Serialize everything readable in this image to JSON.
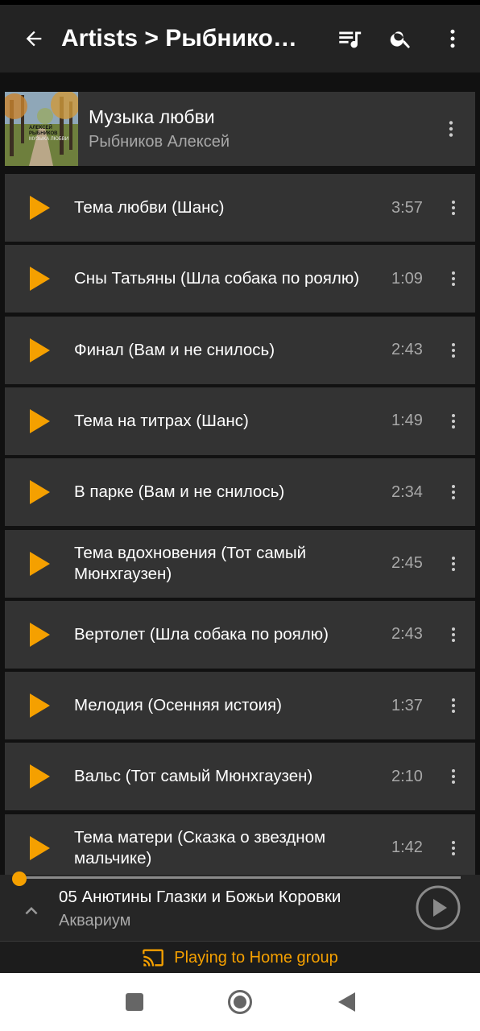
{
  "appbar": {
    "title": "Artists > Рыбников Алексей"
  },
  "album": {
    "title": "Музыка любви",
    "artist": "Рыбников Алексей",
    "cover_text_line1": "АЛЕКСЕЙ",
    "cover_text_line2": "РЫБНИКОВ",
    "cover_text_line3": "МУЗЫКА ЛЮБВИ"
  },
  "tracks": [
    {
      "title": "Тема любви (Шанс)",
      "duration": "3:57"
    },
    {
      "title": "Сны Татьяны (Шла собака по роялю)",
      "duration": "1:09"
    },
    {
      "title": "Финал (Вам и не снилось)",
      "duration": "2:43"
    },
    {
      "title": "Тема на титрах (Шанс)",
      "duration": "1:49"
    },
    {
      "title": "В парке (Вам и не снилось)",
      "duration": "2:34"
    },
    {
      "title": "Тема вдохновения (Тот самый Мюнхгаузен)",
      "duration": "2:45"
    },
    {
      "title": "Вертолет (Шла собака по роялю)",
      "duration": "2:43"
    },
    {
      "title": "Мелодия (Осенняя истоия)",
      "duration": "1:37"
    },
    {
      "title": "Вальс (Тот самый Мюнхгаузен)",
      "duration": "2:10"
    },
    {
      "title": "Тема матери (Сказка о звездном мальчике)",
      "duration": "1:42"
    }
  ],
  "now_playing": {
    "title": "05 Анютины Глазки и Божьи Коровки",
    "artist": "Аквариум",
    "progress": 0.0
  },
  "cast": {
    "label": "Playing to Home group"
  },
  "colors": {
    "accent": "#f5a000",
    "card": "#333333",
    "background": "#111111"
  }
}
